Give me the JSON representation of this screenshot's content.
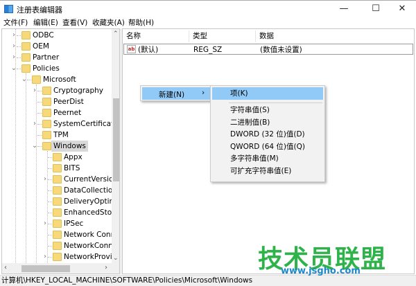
{
  "window": {
    "title": "注册表编辑器",
    "minimize": "—",
    "maximize": "☐",
    "close": "✕"
  },
  "menu": [
    "文件(F)",
    "编辑(E)",
    "查看(V)",
    "收藏夹(A)",
    "帮助(H)"
  ],
  "tree": [
    {
      "label": "ODBC",
      "level": 0,
      "expander": "collapsed"
    },
    {
      "label": "OEM",
      "level": 0,
      "expander": "collapsed"
    },
    {
      "label": "Partner",
      "level": 0,
      "expander": "collapsed"
    },
    {
      "label": "Policies",
      "level": 0,
      "expander": "expanded"
    },
    {
      "label": "Microsoft",
      "level": 1,
      "expander": "expanded"
    },
    {
      "label": "Cryptography",
      "level": 2,
      "expander": "collapsed"
    },
    {
      "label": "PeerDist",
      "level": 2,
      "expander": "none"
    },
    {
      "label": "Peernet",
      "level": 2,
      "expander": "none"
    },
    {
      "label": "SystemCertificates",
      "level": 2,
      "expander": "collapsed"
    },
    {
      "label": "TPM",
      "level": 2,
      "expander": "none"
    },
    {
      "label": "Windows",
      "level": 2,
      "expander": "expanded",
      "selected": true
    },
    {
      "label": "Appx",
      "level": 3,
      "expander": "none"
    },
    {
      "label": "BITS",
      "level": 3,
      "expander": "none"
    },
    {
      "label": "CurrentVersion",
      "level": 3,
      "expander": "collapsed"
    },
    {
      "label": "DataCollection",
      "level": 3,
      "expander": "none"
    },
    {
      "label": "DeliveryOptimization",
      "level": 3,
      "expander": "none"
    },
    {
      "label": "EnhancedStorage",
      "level": 3,
      "expander": "none"
    },
    {
      "label": "IPSec",
      "level": 3,
      "expander": "collapsed"
    },
    {
      "label": "Network Connections",
      "level": 3,
      "expander": "none"
    },
    {
      "label": "NetworkConnectivity",
      "level": 3,
      "expander": "none"
    },
    {
      "label": "NetworkProvider",
      "level": 3,
      "expander": "collapsed"
    }
  ],
  "list": {
    "columns": [
      "名称",
      "类型",
      "数据"
    ],
    "rows": [
      {
        "name": "(默认)",
        "type": "REG_SZ",
        "data": "(数值未设置)"
      }
    ]
  },
  "context_menu": {
    "item": "新建(N)",
    "arrow": "›"
  },
  "submenu": {
    "items": [
      "项(K)",
      "字符串值(S)",
      "二进制值(B)",
      "DWORD (32 位)值(D)",
      "QWORD (64 位)值(Q)",
      "多字符串值(M)",
      "可扩充字符串值(E)"
    ]
  },
  "status": "计算机\\HKEY_LOCAL_MACHINE\\SOFTWARE\\Policies\\Microsoft\\Windows",
  "watermark": {
    "text": "技术员联盟",
    "url": "www.jsgho.com"
  },
  "colors": {
    "highlight": "#91c9f7",
    "selected": "#d9d9d9"
  }
}
